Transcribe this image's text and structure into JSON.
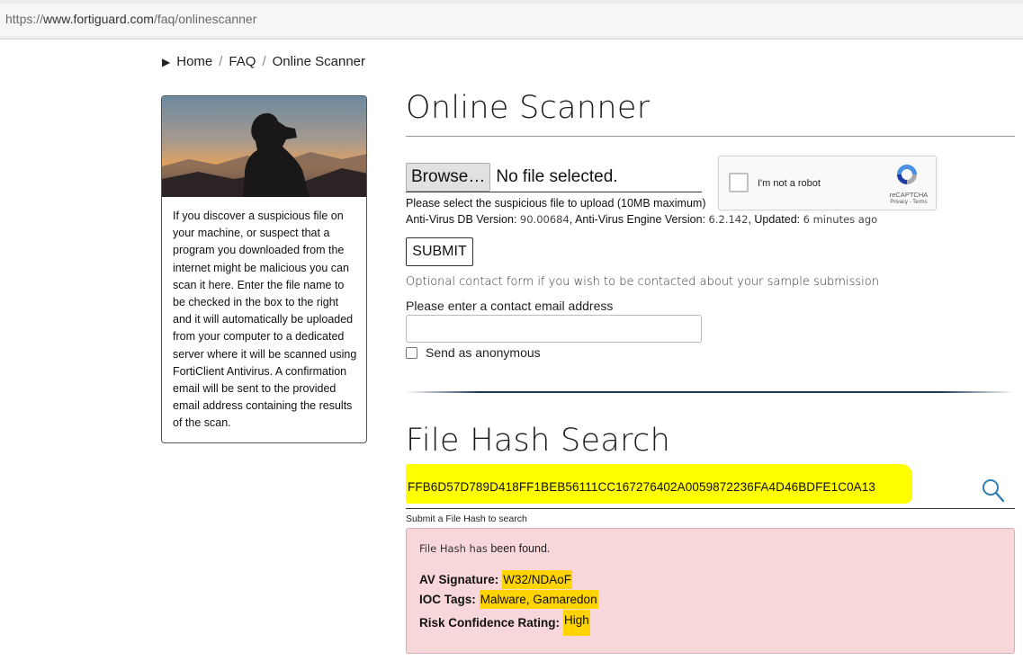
{
  "browser": {
    "url_scheme": "https://",
    "url_host": "www.fortiguard.com",
    "url_path": "/faq/onlinescanner"
  },
  "breadcrumb": {
    "home": "Home",
    "faq": "FAQ",
    "current": "Online Scanner",
    "separator": "/"
  },
  "sidebar": {
    "description": "If you discover a suspicious file on your machine, or suspect that a program you downloaded from the internet might be malicious you can scan it here. Enter the file name to be checked in the box to the right and it will automatically be uploaded from your computer to a dedicated server where it will be scanned using FortiClient Antivirus. A confirmation email will be sent to the provided email address containing the results of the scan."
  },
  "scanner": {
    "title": "Online Scanner",
    "browse_label": "Browse…",
    "file_status": "No file selected.",
    "upload_hint": "Please select the suspicious file to upload (10MB maximum)",
    "db_label": "Anti-Virus DB Version:",
    "db_version": "90.00684",
    "engine_label": "Anti-Virus Engine Version:",
    "engine_version": "6.2.142",
    "updated_label": "Updated:",
    "updated_value": "6 minutes ago",
    "submit_label": "SUBMIT",
    "optional_text": "Optional contact form if you wish to be contacted about your sample submission",
    "email_label": "Please enter a contact email address",
    "email_value": "",
    "anonymous_label": "Send as anonymous",
    "anonymous_checked": false
  },
  "captcha": {
    "label": "I'm not a robot",
    "brand": "reCAPTCHA",
    "privacy": "Privacy",
    "terms": "Terms"
  },
  "hash_search": {
    "title": "File Hash Search",
    "hash_value": "FFB6D57D789D418FF1BEB56111CC167276402A0059872236FA4D46BDFE1C0A13",
    "hint": "Submit a File Hash to search",
    "highlight_color": "#ffff00"
  },
  "result": {
    "found_prefix": "File Hash has",
    "found_suffix": "been found.",
    "av_signature_label": "AV Signature:",
    "av_signature_value": "W32/NDAoF",
    "ioc_tags_label": "IOC Tags:",
    "ioc_tags_value": "Malware, Gamaredon",
    "risk_label": "Risk Confidence Rating:",
    "risk_value": "High",
    "background_color": "#f8d7da",
    "highlight_color": "#ffd400"
  }
}
